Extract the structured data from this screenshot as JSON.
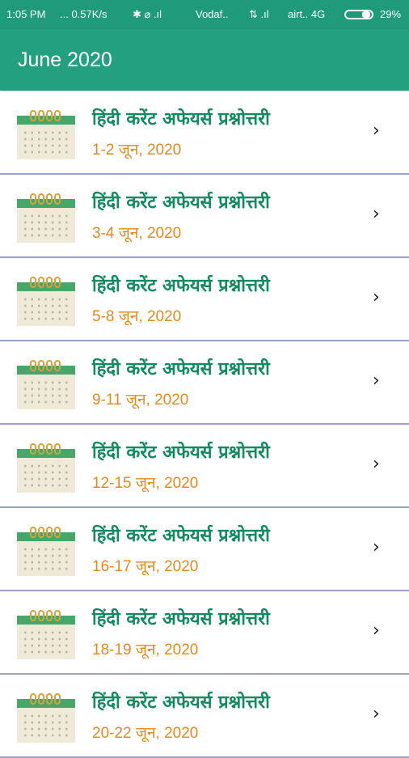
{
  "status": {
    "time": "1:05 PM",
    "speed": "... 0.57K/s",
    "icons": "✱ ⌀ .ıl",
    "carrier1": "Vodaf..",
    "signal": "⇅ .ıl",
    "carrier2": "airt.. 4G",
    "battery": "29%"
  },
  "header": {
    "title": "June 2020"
  },
  "items": [
    {
      "title": "हिंदी करेंट अफेयर्स प्रश्नोत्तरी",
      "date": "1-2 जून, 2020"
    },
    {
      "title": "हिंदी करेंट अफेयर्स प्रश्नोत्तरी",
      "date": "3-4 जून, 2020"
    },
    {
      "title": "हिंदी करेंट अफेयर्स प्रश्नोत्तरी",
      "date": "5-8 जून, 2020"
    },
    {
      "title": "हिंदी करेंट अफेयर्स प्रश्नोत्तरी",
      "date": "9-11 जून, 2020"
    },
    {
      "title": "हिंदी करेंट अफेयर्स प्रश्नोत्तरी",
      "date": "12-15 जून, 2020"
    },
    {
      "title": "हिंदी करेंट अफेयर्स प्रश्नोत्तरी",
      "date": "16-17 जून, 2020"
    },
    {
      "title": "हिंदी करेंट अफेयर्स प्रश्नोत्तरी",
      "date": "18-19 जून, 2020"
    },
    {
      "title": "हिंदी करेंट अफेयर्स प्रश्नोत्तरी",
      "date": "20-22 जून, 2020"
    }
  ],
  "icons": {
    "item_icon": "calendar-icon",
    "arrow": "chevron-right-icon"
  },
  "colors": {
    "header": "#23a07f",
    "title_text": "#118b5e",
    "date_text": "#e38a1d",
    "divider": "#9aa0c8"
  }
}
